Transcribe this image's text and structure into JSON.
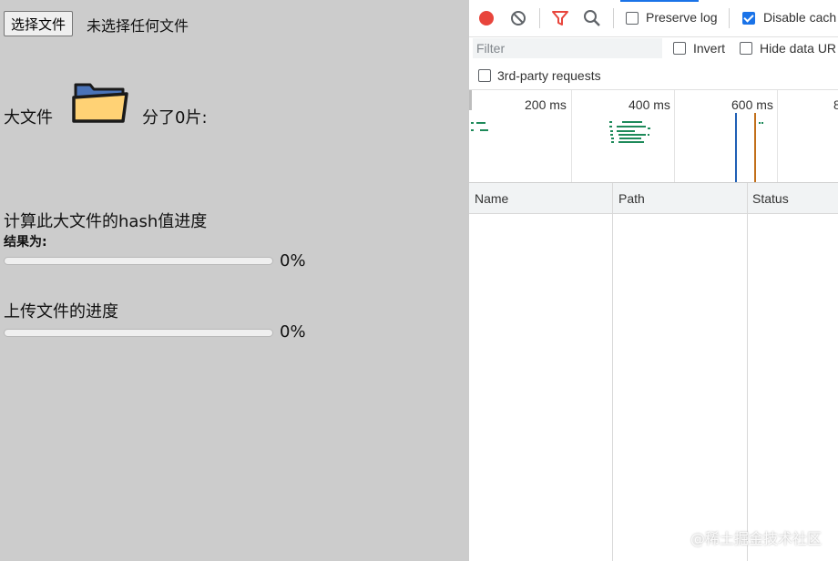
{
  "page": {
    "choose_file_button": "选择文件",
    "no_file_text": "未选择任何文件",
    "big_file_label": "大文件",
    "pieces_text": "分了0片:",
    "hash_title": "计算此大文件的hash值进度",
    "result_label": "结果为:",
    "hash_progress": 0,
    "hash_percent": "0%",
    "upload_title": "上传文件的进度",
    "upload_progress": 0,
    "upload_percent": "0%"
  },
  "devtools": {
    "icons": [
      "record-icon",
      "clear-icon",
      "filter-icon",
      "search-icon"
    ],
    "preserve_log": {
      "label": "Preserve log",
      "checked": false
    },
    "disable_cache": {
      "label": "Disable cach",
      "checked": true
    },
    "filter_placeholder": "Filter",
    "invert": {
      "label": "Invert",
      "checked": false
    },
    "hide_data_urls": {
      "label": "Hide data UR",
      "checked": false
    },
    "third_party": {
      "label": "3rd-party requests",
      "checked": false
    },
    "timeline_ticks": [
      "200 ms",
      "400 ms",
      "600 ms",
      "8"
    ],
    "columns": [
      "Name",
      "Path",
      "Status"
    ],
    "colors": {
      "record": "#e8453c",
      "accent": "#1a73e8",
      "bar_green": "#1e8a5a",
      "dom_blue": "#1f5fb5",
      "load_orange": "#c26f1a"
    }
  },
  "watermark": "@稀土掘金技术社区"
}
